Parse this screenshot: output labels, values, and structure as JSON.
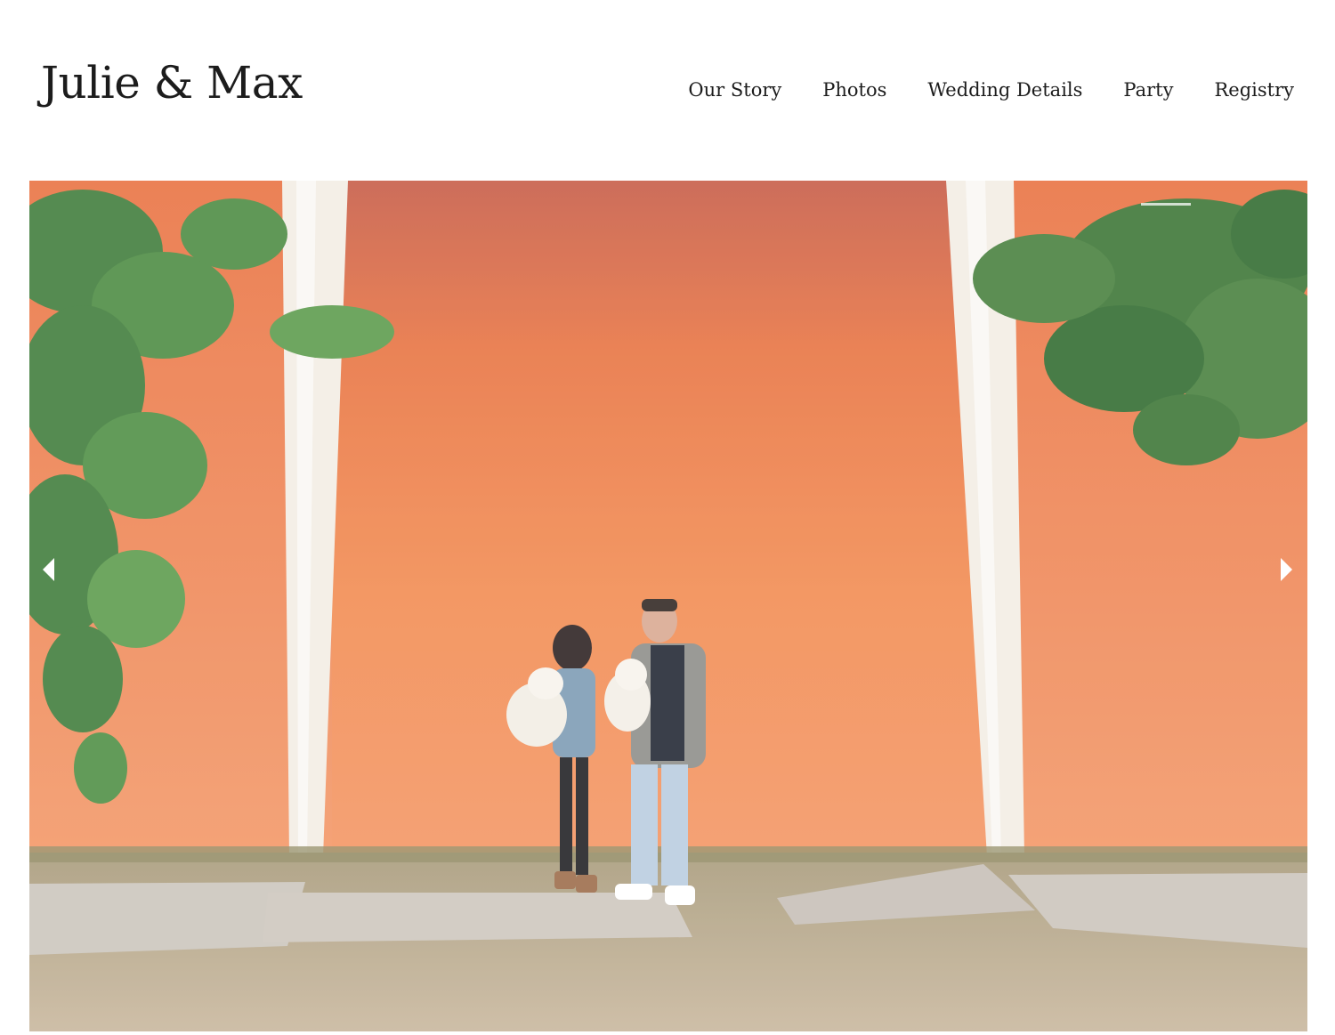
{
  "site": {
    "title": "Julie & Max"
  },
  "nav": {
    "items": [
      {
        "label": "Our Story"
      },
      {
        "label": "Photos"
      },
      {
        "label": "Wedding Details"
      },
      {
        "label": "Party"
      },
      {
        "label": "Registry"
      }
    ]
  },
  "slideshow": {
    "icons": {
      "prev": "chevron-left-icon",
      "next": "chevron-right-icon"
    },
    "photo_description_colors": {
      "wall": "#f0884f",
      "wall_top": "#c95a42",
      "pillar": "#f5efe6",
      "foliage": "#3f7d3a",
      "ground": "#b9a48a",
      "sidewalk": "#c9c2ba"
    }
  }
}
